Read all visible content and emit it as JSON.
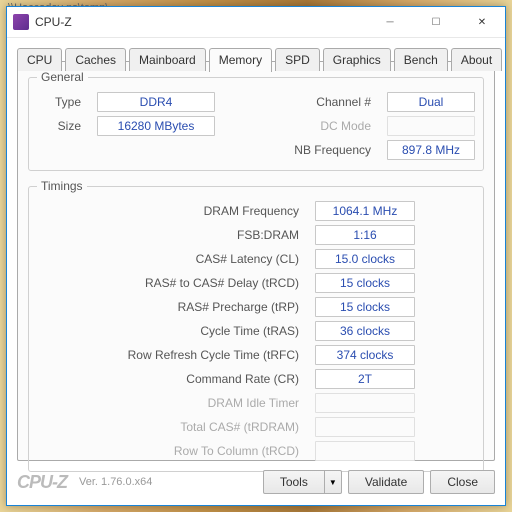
{
  "bgTitle": "\\\\Haccaday ps\\temp\\",
  "window": {
    "title": "CPU-Z"
  },
  "tabs": [
    "CPU",
    "Caches",
    "Mainboard",
    "Memory",
    "SPD",
    "Graphics",
    "Bench",
    "About"
  ],
  "activeTab": 3,
  "general": {
    "legend": "General",
    "type": {
      "label": "Type",
      "value": "DDR4"
    },
    "size": {
      "label": "Size",
      "value": "16280 MBytes"
    },
    "channel": {
      "label": "Channel #",
      "value": "Dual"
    },
    "dcmode": {
      "label": "DC Mode",
      "value": ""
    },
    "nbfreq": {
      "label": "NB Frequency",
      "value": "897.8 MHz"
    }
  },
  "timings": {
    "legend": "Timings",
    "rows": [
      {
        "label": "DRAM Frequency",
        "value": "1064.1 MHz"
      },
      {
        "label": "FSB:DRAM",
        "value": "1:16"
      },
      {
        "label": "CAS# Latency (CL)",
        "value": "15.0 clocks"
      },
      {
        "label": "RAS# to CAS# Delay (tRCD)",
        "value": "15 clocks"
      },
      {
        "label": "RAS# Precharge (tRP)",
        "value": "15 clocks"
      },
      {
        "label": "Cycle Time (tRAS)",
        "value": "36 clocks"
      },
      {
        "label": "Row Refresh Cycle Time (tRFC)",
        "value": "374 clocks"
      },
      {
        "label": "Command Rate (CR)",
        "value": "2T"
      },
      {
        "label": "DRAM Idle Timer",
        "value": ""
      },
      {
        "label": "Total CAS# (tRDRAM)",
        "value": ""
      },
      {
        "label": "Row To Column (tRCD)",
        "value": ""
      }
    ]
  },
  "footer": {
    "brand": "CPU-Z",
    "version": "Ver. 1.76.0.x64",
    "tools": "Tools",
    "validate": "Validate",
    "close": "Close"
  }
}
